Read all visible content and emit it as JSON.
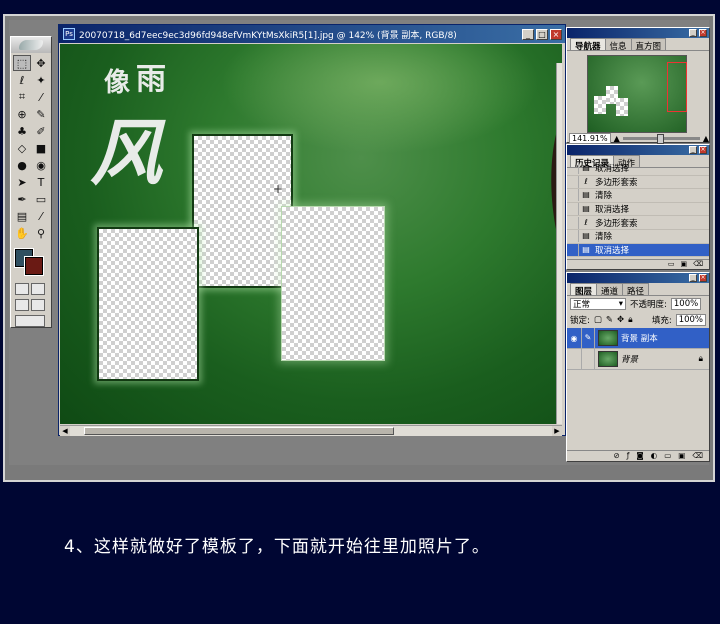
{
  "document": {
    "title": "20070718_6d7eec9ec3d96fd948efVmKYtMsXkiR5[1].jpg @ 142% (背景 副本, RGB/8)",
    "ps_icon": "Ps",
    "calligraphy": [
      "像",
      "雨",
      "风"
    ]
  },
  "navigator": {
    "tabs": [
      "导航器",
      "信息",
      "直方图"
    ],
    "zoom": "141.91%"
  },
  "history": {
    "tabs": [
      "历史记录",
      "动作"
    ],
    "items": [
      {
        "label": "取消选择",
        "icon": "doc-icon"
      },
      {
        "label": "多边形套索",
        "icon": "lasso-icon"
      },
      {
        "label": "清除",
        "icon": "doc-icon"
      },
      {
        "label": "取消选择",
        "icon": "doc-icon"
      },
      {
        "label": "多边形套索",
        "icon": "lasso-icon"
      },
      {
        "label": "清除",
        "icon": "doc-icon"
      },
      {
        "label": "取消选择",
        "icon": "doc-icon"
      }
    ]
  },
  "layers": {
    "tabs": [
      "图层",
      "通道",
      "路径"
    ],
    "blend_mode": "正常",
    "opacity_label": "不透明度:",
    "opacity": "100%",
    "lock_label": "锁定:",
    "fill_label": "填充:",
    "fill": "100%",
    "items": [
      {
        "name": "背景 副本"
      },
      {
        "name": "背景"
      }
    ]
  },
  "caption": "4、这样就做好了模板了，下面就开始往里加照片了。"
}
